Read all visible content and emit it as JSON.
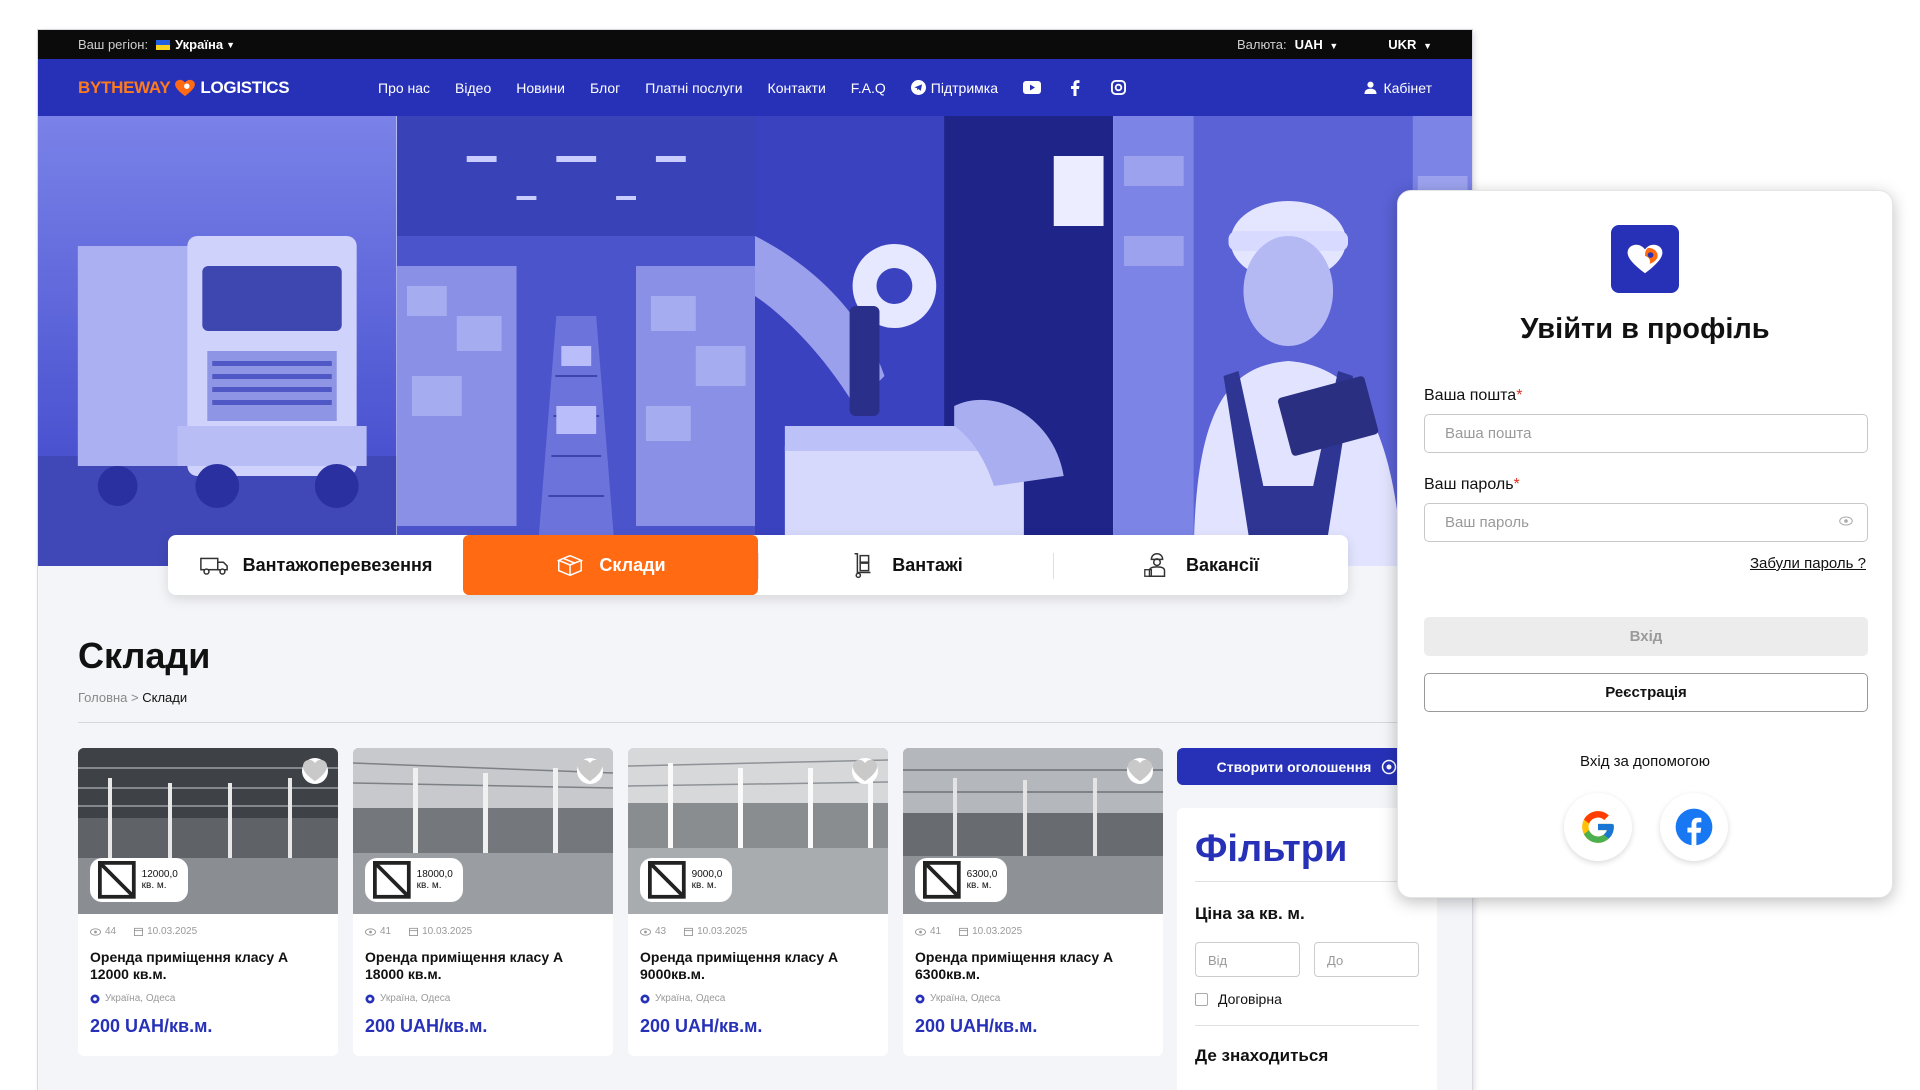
{
  "topbar": {
    "region_label": "Ваш регіон:",
    "region_value": "Україна",
    "currency_label": "Валюта:",
    "currency_value": "UAH",
    "language": "UKR"
  },
  "nav": {
    "logo_part1": "BYTHEWAY",
    "logo_part2": "LOGISTICS",
    "links": [
      "Про нас",
      "Відео",
      "Новини",
      "Блог",
      "Платні послуги",
      "Контакти",
      "F.A.Q"
    ],
    "support": "Підтримка",
    "cabinet": "Кабінет"
  },
  "categories": [
    {
      "label": "Вантажоперевезення",
      "icon": "truck-icon",
      "active": false
    },
    {
      "label": "Склади",
      "icon": "boxes-icon",
      "active": true
    },
    {
      "label": "Вантажі",
      "icon": "hand-truck-icon",
      "active": false
    },
    {
      "label": "Вакансії",
      "icon": "worker-icon",
      "active": false
    }
  ],
  "page": {
    "title": "Склади",
    "breadcrumb_home": "Головна",
    "breadcrumb_sep": ">",
    "breadcrumb_current": "Склади"
  },
  "listings": [
    {
      "area": "12000,0 кв. м.",
      "views": "44",
      "date": "10.03.2025",
      "title": "Оренда приміщення класу А 12000 кв.м.",
      "location": "Україна, Одеса",
      "price": "200 UAH/кв.м."
    },
    {
      "area": "18000,0 кв. м.",
      "views": "41",
      "date": "10.03.2025",
      "title": "Оренда приміщення класу А 18000 кв.м.",
      "location": "Україна, Одеса",
      "price": "200 UAH/кв.м."
    },
    {
      "area": "9000,0 кв. м.",
      "views": "43",
      "date": "10.03.2025",
      "title": "Оренда приміщення класу А 9000кв.м.",
      "location": "Україна, Одеса",
      "price": "200 UAH/кв.м."
    },
    {
      "area": "6300,0 кв. м.",
      "views": "41",
      "date": "10.03.2025",
      "title": "Оренда приміщення класу А 6300кв.м.",
      "location": "Україна, Одеса",
      "price": "200 UAH/кв.м."
    }
  ],
  "sidebar": {
    "create_button": "Створити оголошення",
    "filters_title": "Фільтри",
    "price_label": "Ціна за кв. м.",
    "price_from_placeholder": "Від",
    "price_to_placeholder": "До",
    "negotiable": "Договірна",
    "location_label": "Де знаходиться"
  },
  "login": {
    "title": "Увійти в профіль",
    "email_label": "Ваша пошта",
    "email_placeholder": "Ваша пошта",
    "password_label": "Ваш пароль",
    "password_placeholder": "Ваш пароль",
    "required_mark": "*",
    "forgot": "Забули пароль ?",
    "login_button": "Вхід",
    "register_button": "Реєстрація",
    "social_label": "Вхід за допомогою"
  },
  "colors": {
    "brand_blue": "#2731b8",
    "accent_orange": "#ff6a13",
    "topbar_black": "#0b0b0b"
  }
}
